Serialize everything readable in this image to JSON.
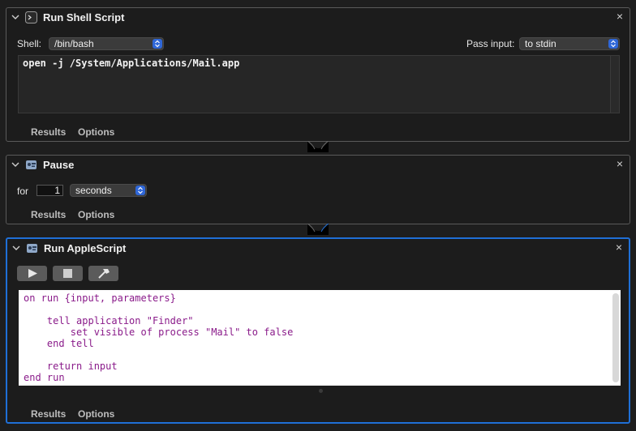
{
  "actions": {
    "shell": {
      "title": "Run Shell Script",
      "shell_label": "Shell:",
      "shell_value": "/bin/bash",
      "pass_input_label": "Pass input:",
      "pass_input_value": "to stdin",
      "code": "open -j /System/Applications/Mail.app",
      "tabs": [
        "Results",
        "Options"
      ],
      "icon": "terminal-icon"
    },
    "pause": {
      "title": "Pause",
      "for_label": "for",
      "amount": "1",
      "unit": "seconds",
      "tabs": [
        "Results",
        "Options"
      ],
      "icon": "automator-action-icon"
    },
    "applescript": {
      "title": "Run AppleScript",
      "lines": [
        "on run {input, parameters}",
        "",
        "    tell application \"Finder\"",
        "        set visible of process \"Mail\" to false",
        "    end tell",
        "",
        "    return input",
        "end run"
      ],
      "tabs": [
        "Results",
        "Options"
      ],
      "icon": "automator-action-icon",
      "toolbar": [
        "run-icon",
        "stop-icon",
        "compile-icon"
      ]
    }
  },
  "close_glyph": "×",
  "colors": {
    "accent": "#1f6fd6",
    "script_text": "#8a1b8a",
    "background": "#1e1e1e"
  }
}
